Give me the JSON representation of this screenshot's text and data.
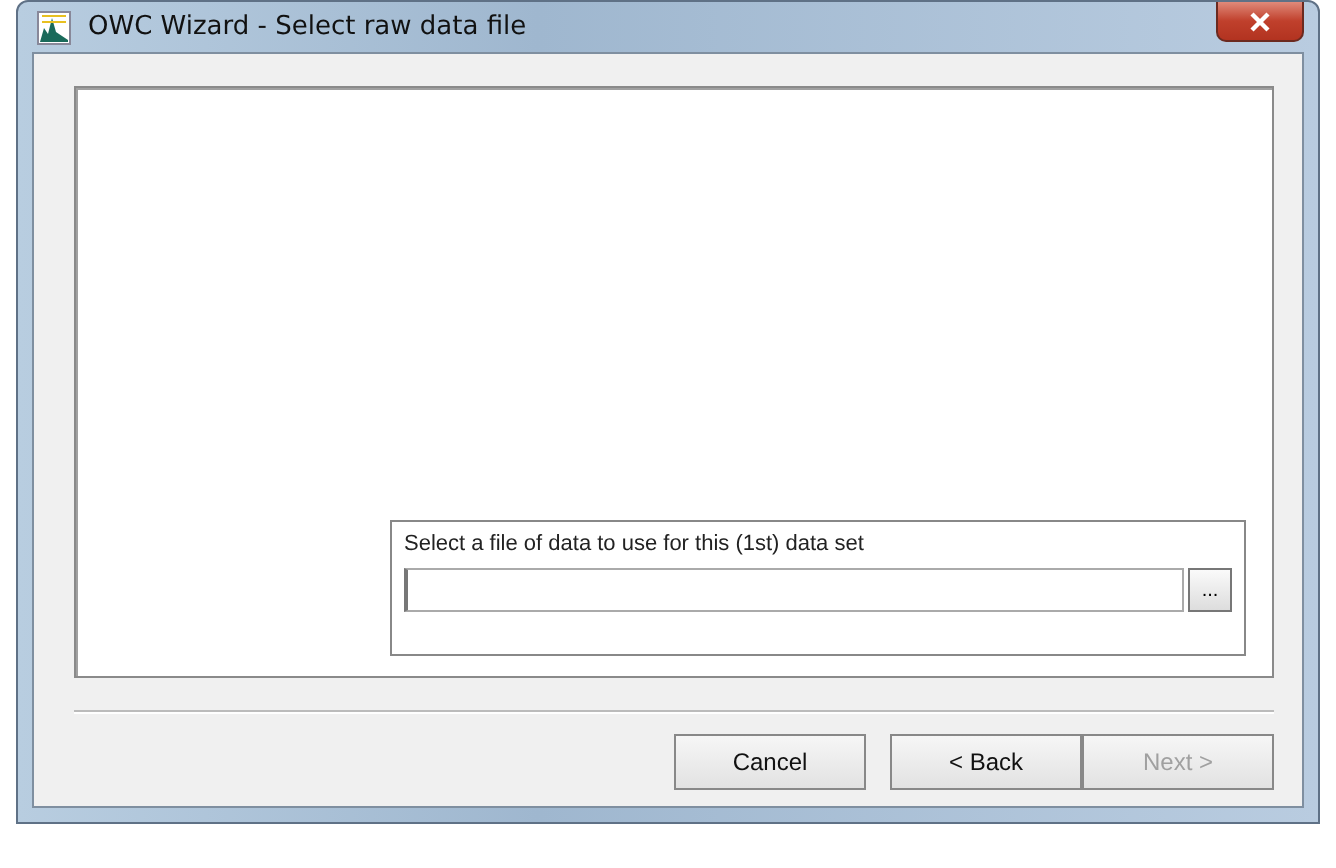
{
  "window": {
    "title": "OWC Wizard - Select raw data file"
  },
  "file_group": {
    "label": "Select a file of data to use for this (1st) data set",
    "browse_button": "..."
  },
  "buttons": [
    {
      "label": "Cancel",
      "disabled": false
    },
    {
      "label": "< Back",
      "disabled": false
    },
    {
      "label": "Next >",
      "disabled": true
    }
  ]
}
